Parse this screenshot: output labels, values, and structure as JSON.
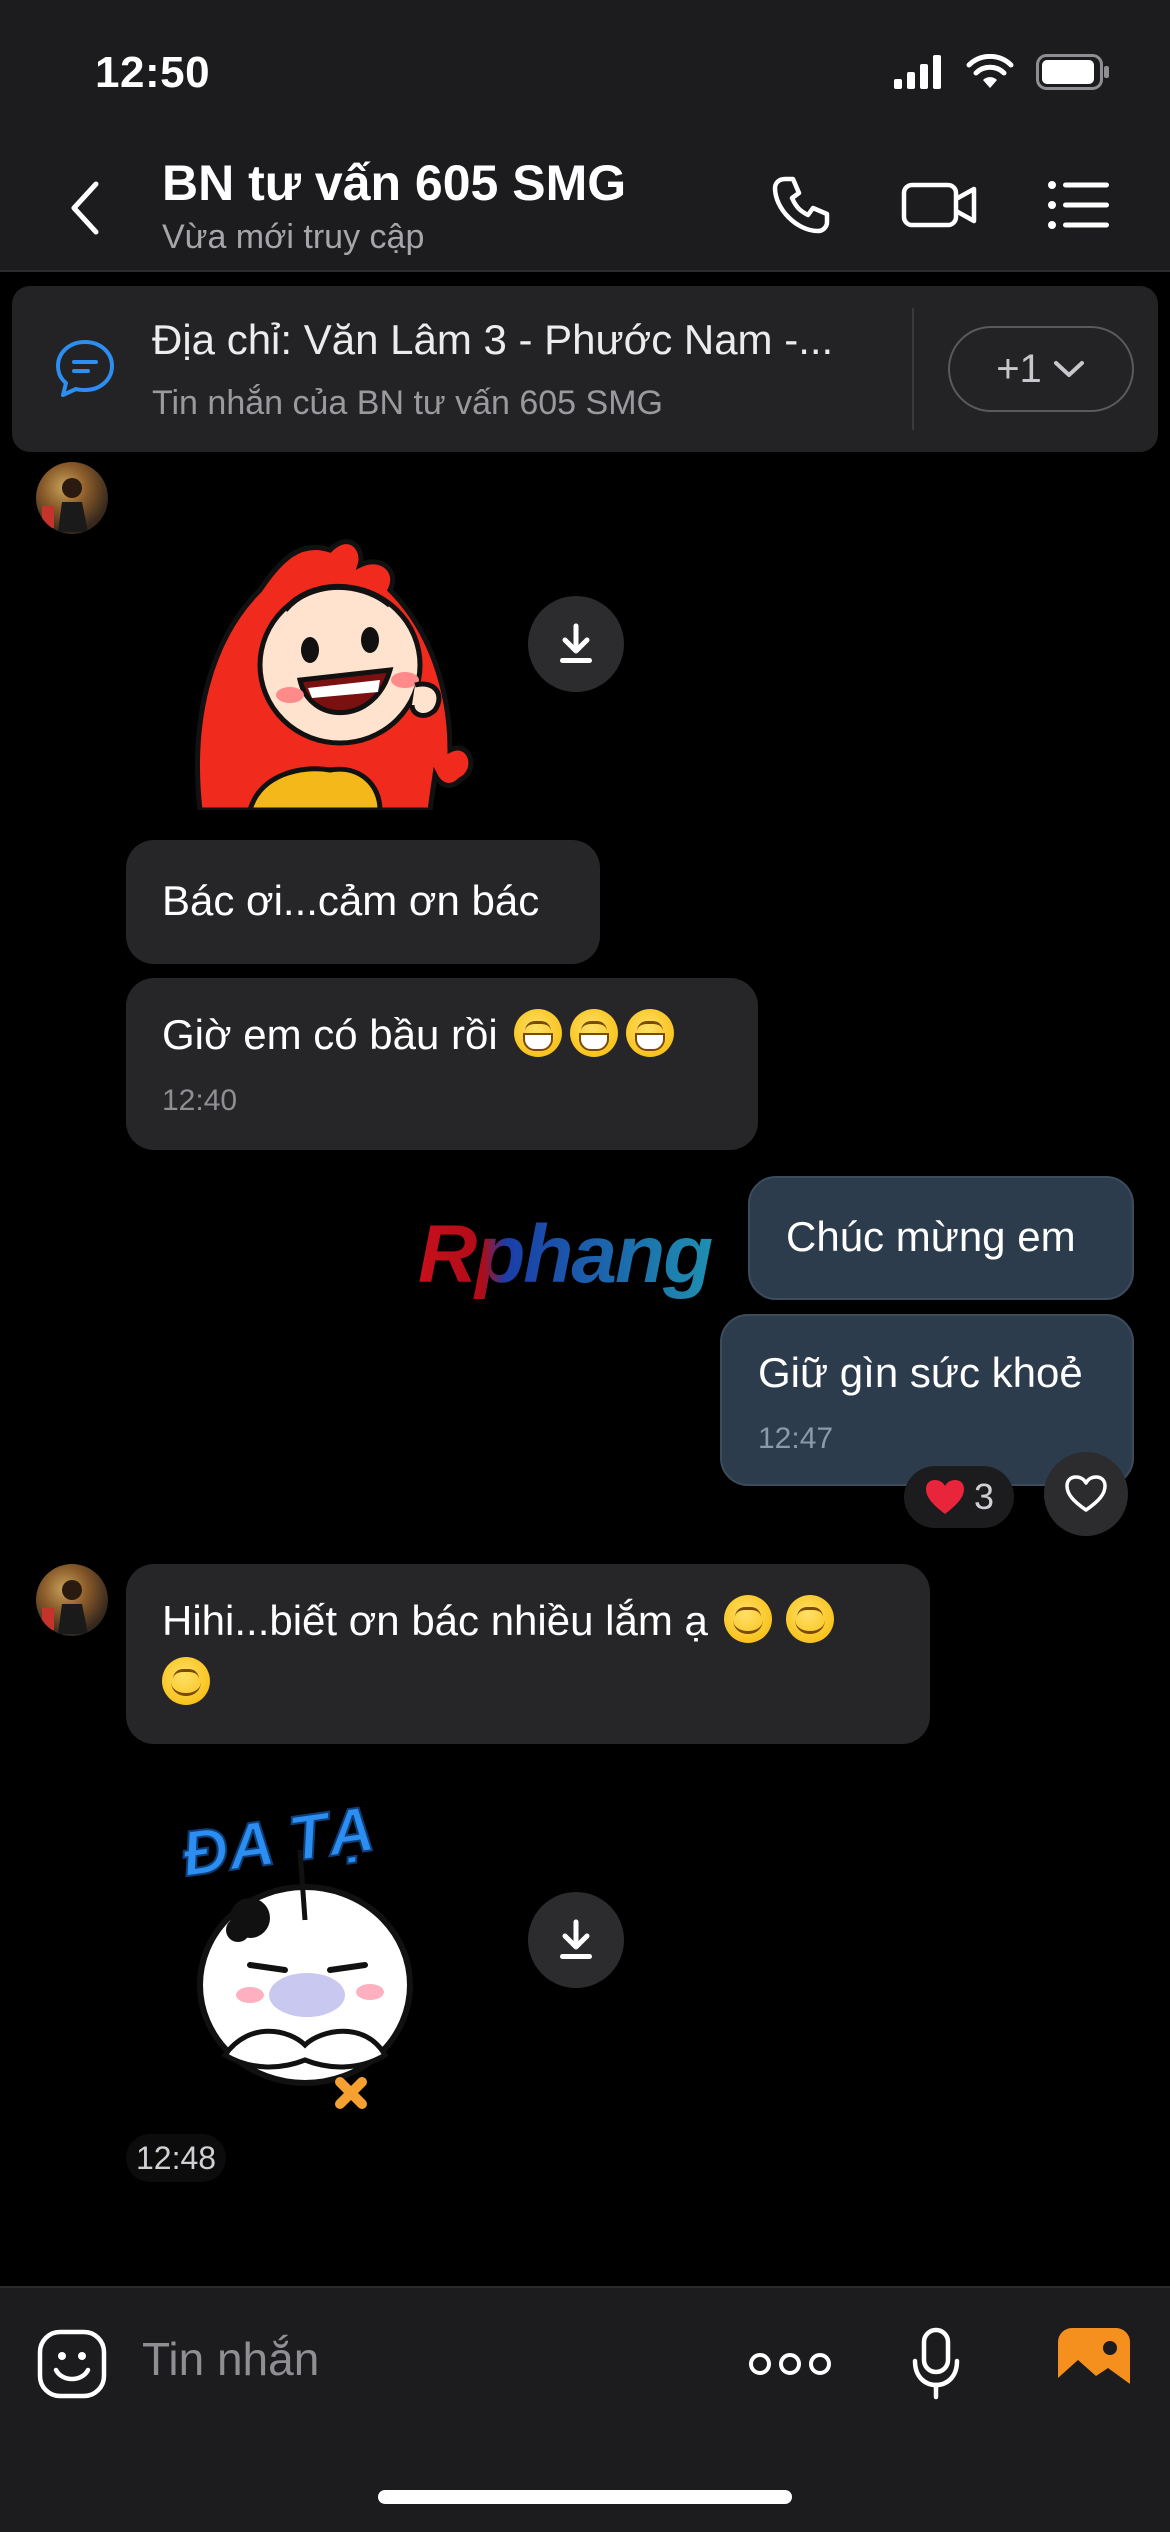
{
  "status_bar": {
    "time": "12:50"
  },
  "header": {
    "title": "BN tư vấn 605 SMG",
    "subtitle": "Vừa mới truy cập"
  },
  "pinned": {
    "text": "Địa chỉ: Văn Lâm 3 - Phước Nam -...",
    "sub": "Tin nhắn của BN tư vấn 605 SMG",
    "count": "+1"
  },
  "messages": {
    "m1": "Bác ơi...cảm ơn bác",
    "m2": "Giờ em có bầu rồi",
    "m2_time": "12:40",
    "m3": "Chúc mừng em",
    "m4": "Giữ gìn sức khoẻ",
    "m4_time": "12:47",
    "m5": "Hihi...biết ơn bác nhiều lắm ạ",
    "sticker2_time": "12:48"
  },
  "reaction": {
    "count": "3"
  },
  "stickers": {
    "sticker2_text": "ĐA TẠ"
  },
  "watermark": {
    "text": "Rphang"
  },
  "input": {
    "placeholder": "Tin nhắn"
  },
  "colors": {
    "background": "#000000",
    "header": "#1c1c1e",
    "incoming_bubble": "#262628",
    "outgoing_bubble": "#2c3c4c",
    "accent_blue": "#2b8ef0",
    "heart_red": "#e8253b"
  },
  "icons": {
    "back": "chevron-left-icon",
    "call": "phone-icon",
    "video": "video-camera-icon",
    "menu": "list-menu-icon",
    "pinned": "chat-bubble-icon",
    "download": "download-icon",
    "heart": "heart-icon",
    "sticker": "emoji-face-icon",
    "more": "more-dots-icon",
    "mic": "microphone-icon",
    "gallery": "image-gallery-icon"
  }
}
